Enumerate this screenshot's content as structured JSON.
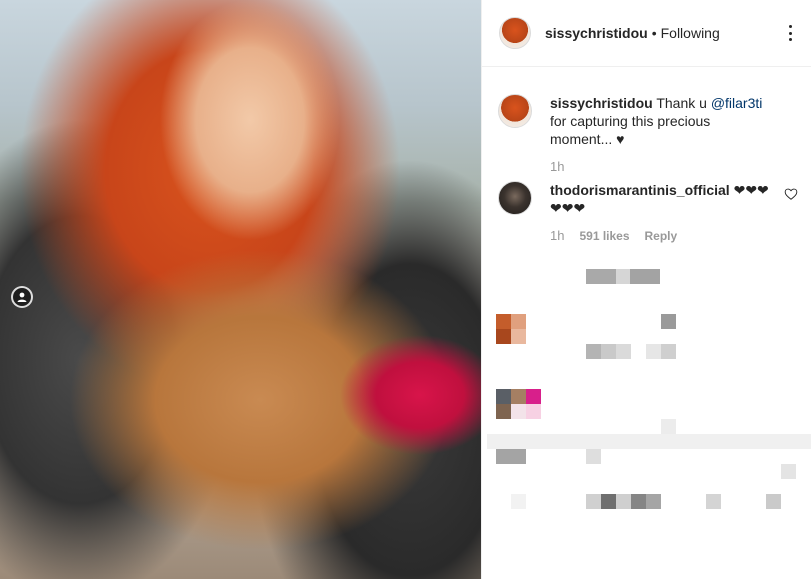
{
  "header": {
    "username": "sissychristidou",
    "separator": "•",
    "follow_status": "Following"
  },
  "caption": {
    "username": "sissychristidou",
    "text_before": "Thank u ",
    "mention": "@filar3ti",
    "text_after": " for capturing this precious moment... ♥",
    "time": "1h"
  },
  "comments": [
    {
      "username": "thodorismarantinis_official",
      "text": "❤❤❤ ❤❤❤",
      "time": "1h",
      "likes": "591 likes",
      "reply": "Reply"
    }
  ],
  "colors": {
    "link": "#003569",
    "meta": "#999999",
    "border": "#efefef"
  }
}
